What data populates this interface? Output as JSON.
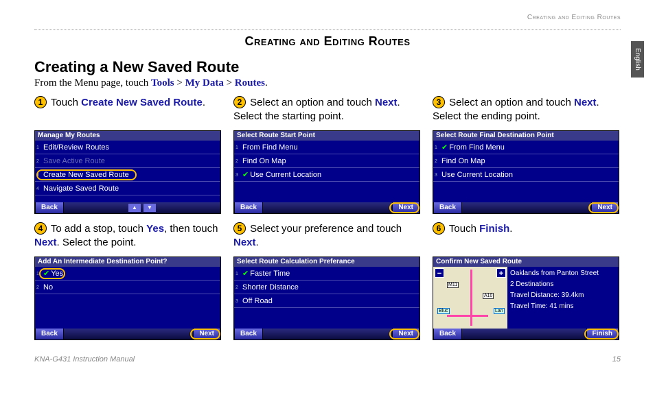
{
  "headerSmall": "Creating and Editing Routes",
  "langTab": "English",
  "sectionTitle": "Creating and Editing Routes",
  "subsectionTitle": "Creating a New Saved Route",
  "breadcrumb": {
    "prefix": "From the Menu page, touch ",
    "p1": "Tools",
    "sep": " > ",
    "p2": "My Data",
    "p3": "Routes",
    "suffix": "."
  },
  "steps": {
    "s1": {
      "num": "1",
      "t1": "Touch ",
      "b1": "Create New Saved Route",
      "t2": "."
    },
    "s2": {
      "num": "2",
      "t1": "Select an option and touch ",
      "b1": "Next",
      "t2": ". Select the starting point."
    },
    "s3": {
      "num": "3",
      "t1": "Select an option and touch ",
      "b1": "Next",
      "t2": ". Select the ending point."
    },
    "s4": {
      "num": "4",
      "t1": "To add a stop, touch ",
      "b1": "Yes",
      "t2": ", then touch ",
      "b2": "Next",
      "t3": ". Select the point."
    },
    "s5": {
      "num": "5",
      "t1": "Select your preference and touch ",
      "b1": "Next",
      "t2": "."
    },
    "s6": {
      "num": "6",
      "t1": "Touch ",
      "b1": "Finish",
      "t2": "."
    }
  },
  "screens": {
    "sc1": {
      "title": "Manage My Routes",
      "rows": [
        "Edit/Review Routes",
        "Save Active Route",
        "Create New Saved Route",
        "Navigate Saved Route"
      ],
      "back": "Back"
    },
    "sc2": {
      "title": "Select Route Start Point",
      "rows": [
        "From Find Menu",
        "Find On Map",
        "Use Current Location"
      ],
      "back": "Back",
      "next": "Next"
    },
    "sc3": {
      "title": "Select Route Final Destination Point",
      "rows": [
        "From Find Menu",
        "Find On Map",
        "Use Current Location"
      ],
      "back": "Back",
      "next": "Next"
    },
    "sc4": {
      "title": "Add An Intermediate Destination Point?",
      "rows": [
        "Yes",
        "No"
      ],
      "back": "Back",
      "next": "Next"
    },
    "sc5": {
      "title": "Select Route Calculation Preferance",
      "rows": [
        "Faster Time",
        "Shorter Distance",
        "Off Road"
      ],
      "back": "Back",
      "next": "Next"
    },
    "sc6": {
      "title": "Confirm New Saved Route",
      "info1": "Oaklands from Panton Street",
      "info2": "2 Destinations",
      "info3": "Travel Distance: 39.4km",
      "info4": "Travel Time: 41 mins",
      "roads": {
        "r1": "M11",
        "r2": "A10",
        "r3": "Bluc",
        "r4": "Lan"
      },
      "back": "Back",
      "finish": "Finish"
    }
  },
  "footer": {
    "manual": "KNA-G431 Instruction Manual",
    "page": "15"
  }
}
